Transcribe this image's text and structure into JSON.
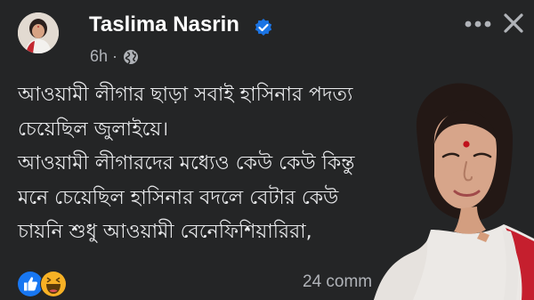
{
  "post": {
    "author": "Taslima Nasrin",
    "time": "6h",
    "separator": "·",
    "lines": [
      "আওয়ামী লীগার ছাড়া সবাই হাসিনার পদত্য",
      "চেয়েছিল জুলাইয়ে।",
      "আওয়ামী লীগারদের মধ্যেও কেউ কেউ  কিন্তু",
      "মনে চেয়েছিল হাসিনার বদলে বেটার কেউ",
      "চায়নি শুধু আওয়ামী বেনেফিশিয়ারিরা,"
    ],
    "comments": "24 comm"
  },
  "icons": {
    "verified": "verified-badge-icon",
    "audience": "globe-icon",
    "more": "more-options-icon",
    "close": "close-icon",
    "reactions": [
      "like-reaction-icon",
      "haha-reaction-icon"
    ]
  },
  "colors": {
    "background": "#242526",
    "text": "#e4e6eb",
    "secondary_text": "#b0b3b8",
    "verified_blue": "#1b74e4",
    "like_blue": "#1877f2",
    "haha_yellow": "#f7b125"
  }
}
